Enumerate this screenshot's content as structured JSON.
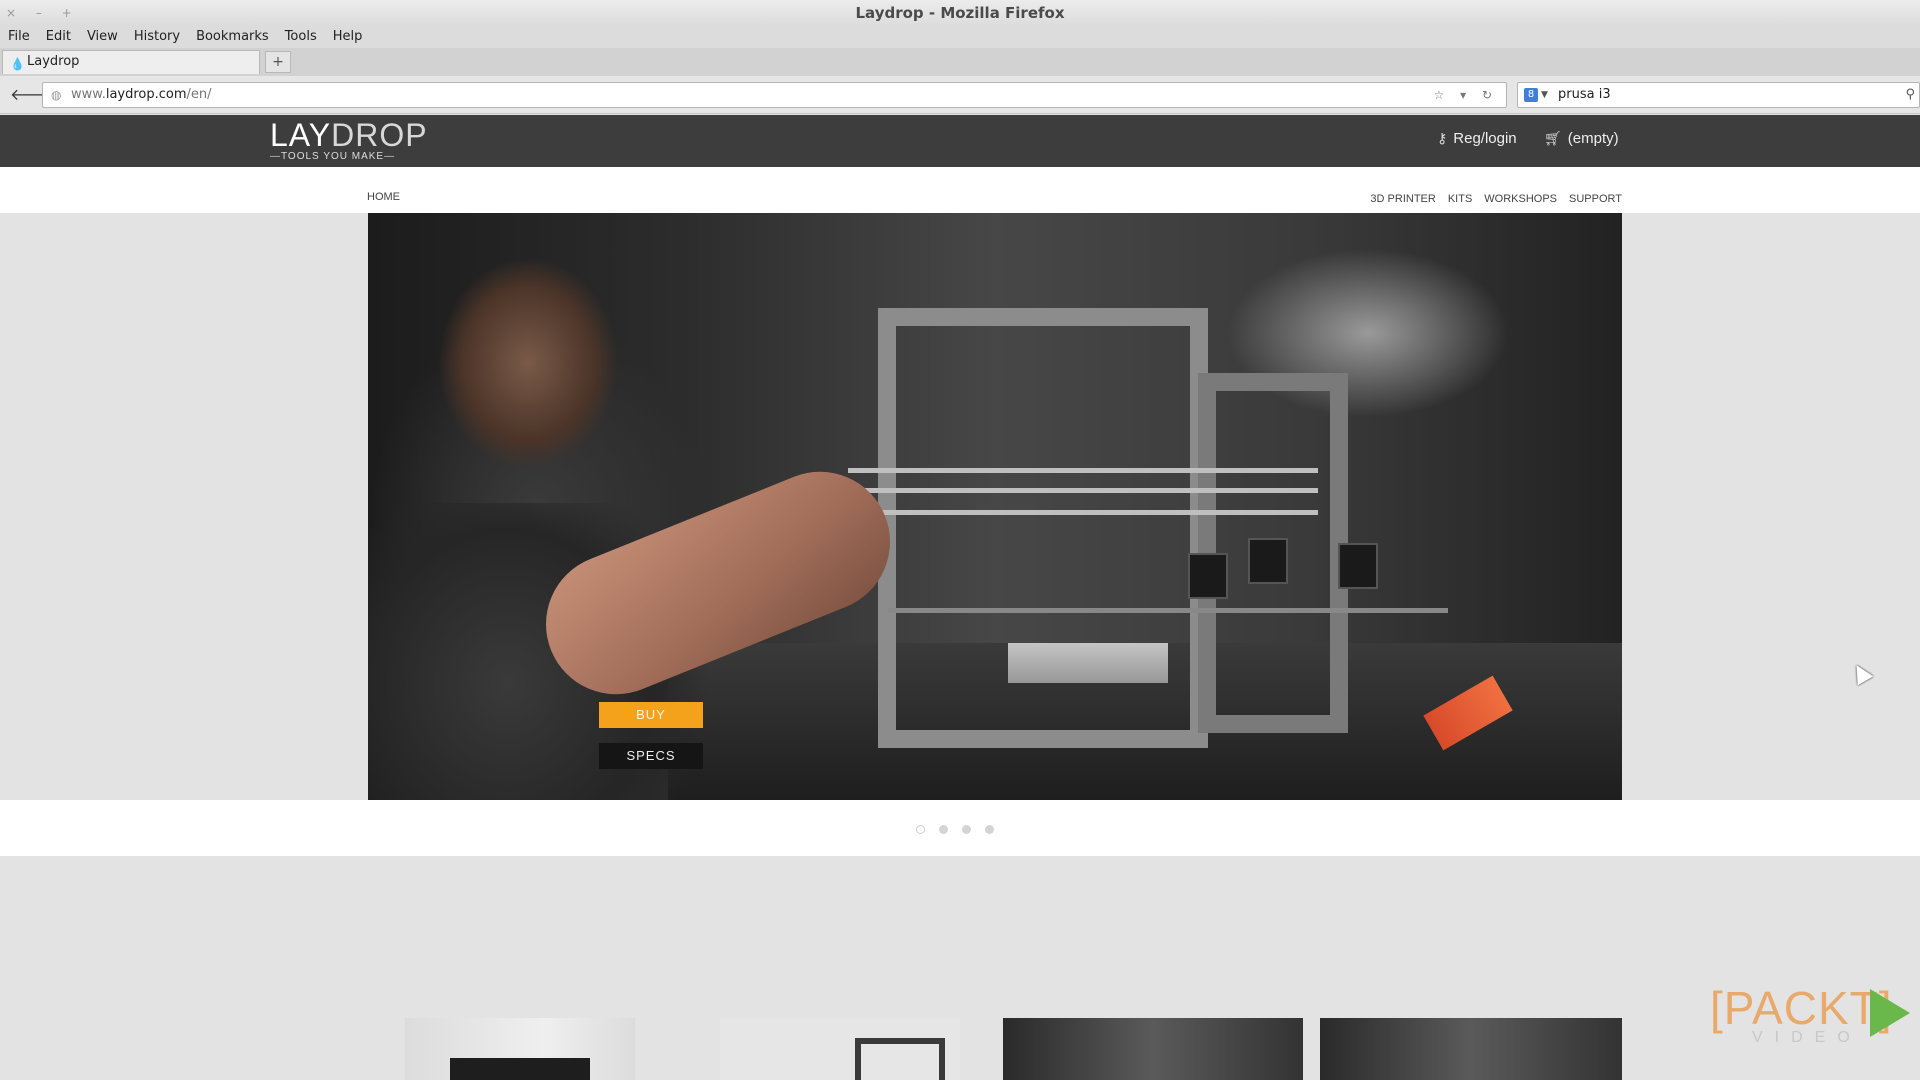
{
  "window": {
    "title": "Laydrop - Mozilla Firefox",
    "controls": "× – +"
  },
  "menu": [
    "File",
    "Edit",
    "View",
    "History",
    "Bookmarks",
    "Tools",
    "Help"
  ],
  "tab": {
    "title": "Laydrop",
    "new_tab": "+"
  },
  "navbar": {
    "back": "🡐",
    "url_prefix": "www.",
    "url_domain": "laydrop.com",
    "url_path": "/en/",
    "url_controls": "☆ ▾ ↻",
    "search_value": "prusa i3",
    "search_engine_letter": "8",
    "search_go": "⚲"
  },
  "site": {
    "logo_lay": "LAY",
    "logo_drop": "DROP",
    "logo_tagline": "TOOLS YOU MAKE",
    "reg_login": "Reg/login",
    "cart": "(empty)",
    "nav_home": "HOME",
    "nav_items": [
      "3D PRINTER",
      "KITS",
      "WORKSHOPS",
      "SUPPORT"
    ],
    "buy": "BUY",
    "specs": "SPECS",
    "carousel_count": 4,
    "carousel_active": 0
  },
  "watermark": {
    "word": "[PACKT]",
    "sub": "VIDEO"
  },
  "colors": {
    "header_bg": "#3d3d3d",
    "buy_button": "#f4a21b",
    "specs_button": "#151515",
    "packt_orange": "#e8a96a",
    "packt_green": "#6ab84b"
  }
}
